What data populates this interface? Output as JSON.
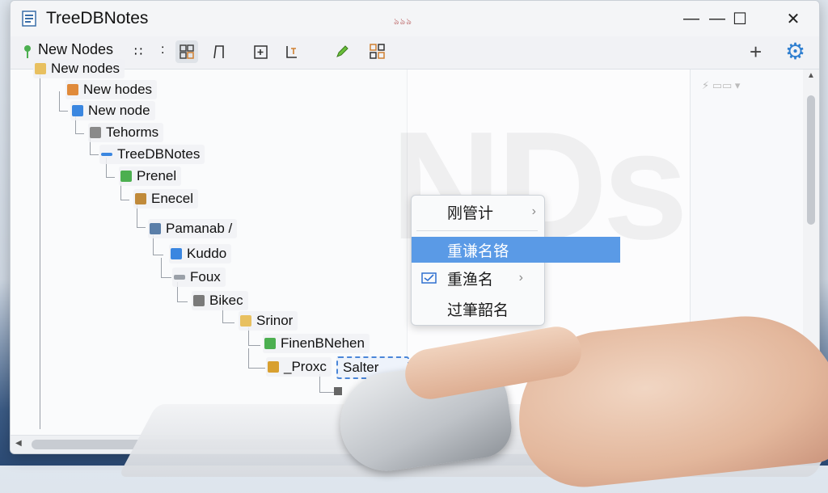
{
  "window": {
    "title": "TreeDBNotes",
    "title_mark": "ঌঌঌ",
    "controls": [
      "—",
      "—",
      "☐",
      "✕"
    ]
  },
  "toolbar": {
    "label": "New Nodes",
    "drag": "∷",
    "sep": ":",
    "add": "+",
    "settings": "⚙"
  },
  "tree": {
    "nodes": [
      {
        "label": "New nodes"
      },
      {
        "label": "New hodes"
      },
      {
        "label": "New node"
      },
      {
        "label": "Tehorms"
      },
      {
        "label": "TreeDBNotes"
      },
      {
        "label": "Prenel"
      },
      {
        "label": "Enecel"
      },
      {
        "label": "Pamanab /"
      },
      {
        "label": "Kuddo"
      },
      {
        "label": "Foux"
      },
      {
        "label": "Bikec"
      },
      {
        "label": "Srinor"
      },
      {
        "label": "FinenBNehen"
      },
      {
        "label": "_Proxc"
      }
    ],
    "rename_value": "Salter"
  },
  "context_menu": {
    "items": [
      {
        "label": "刚管计",
        "has_submenu": true,
        "highlighted": false
      },
      {
        "label": "重谦名铬",
        "has_submenu": false,
        "highlighted": true
      },
      {
        "label": "重渔名",
        "has_submenu": true,
        "highlighted": false
      },
      {
        "label": "过筆韶名",
        "has_submenu": false,
        "highlighted": false
      }
    ]
  },
  "colors": {
    "accent": "#5a9ae6",
    "rename_border": "#4a86d8"
  }
}
